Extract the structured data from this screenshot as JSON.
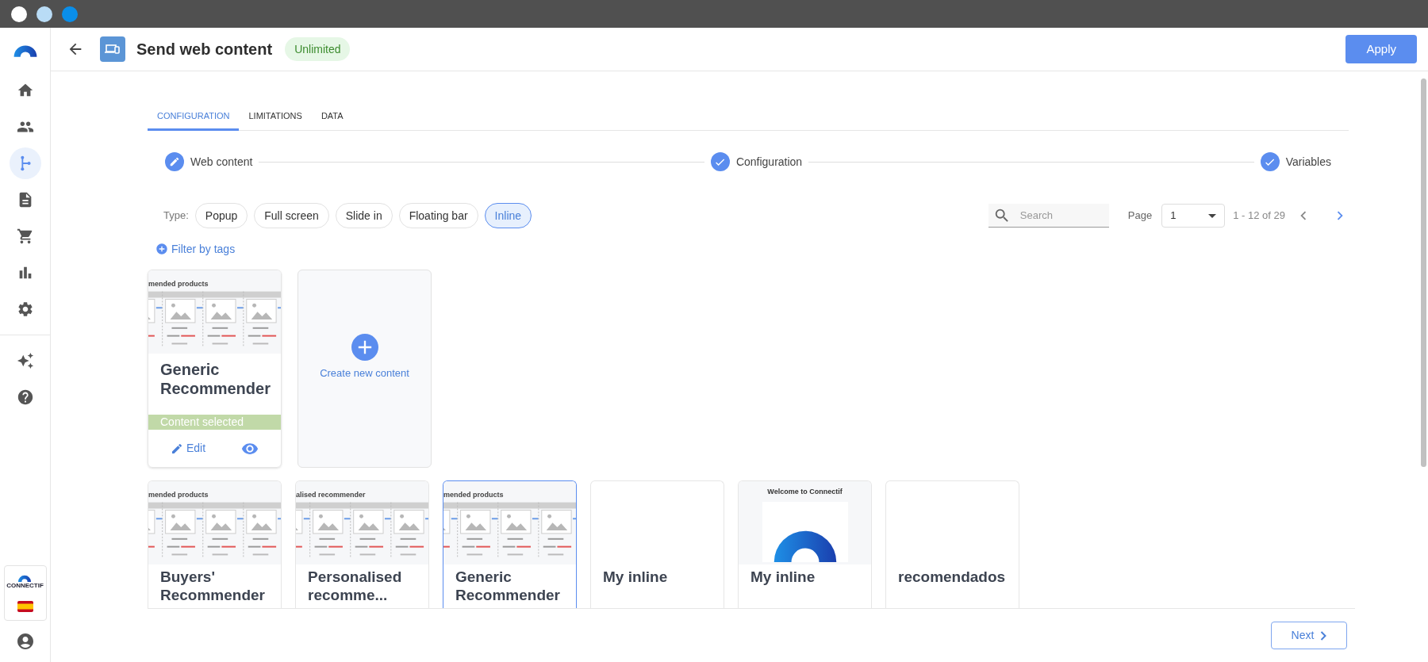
{
  "sidebar": {
    "items": [
      {
        "kind": "home",
        "selected": false
      },
      {
        "kind": "people",
        "selected": false
      },
      {
        "kind": "flow",
        "selected": true
      },
      {
        "kind": "document",
        "selected": false
      },
      {
        "kind": "cart",
        "selected": false
      },
      {
        "kind": "chart",
        "selected": false
      },
      {
        "kind": "settings",
        "selected": false
      },
      {
        "kind": "sparkles",
        "selected": false
      },
      {
        "kind": "help",
        "selected": false
      }
    ],
    "brand_text": "CONNECTIF"
  },
  "header": {
    "title": "Send web content",
    "badge": "Unlimited",
    "apply": "Apply"
  },
  "tabs": [
    {
      "label": "CONFIGURATION",
      "selected": true
    },
    {
      "label": "LIMITATIONS",
      "selected": false
    },
    {
      "label": "DATA",
      "selected": false
    }
  ],
  "steps": [
    {
      "label": "Web content",
      "kind": "edit"
    },
    {
      "label": "Configuration",
      "kind": "done"
    },
    {
      "label": "Variables",
      "kind": "done"
    }
  ],
  "type_filter": {
    "label": "Type:",
    "options": [
      {
        "label": "Popup",
        "selected": false
      },
      {
        "label": "Full screen",
        "selected": false
      },
      {
        "label": "Slide in",
        "selected": false
      },
      {
        "label": "Floating bar",
        "selected": false
      },
      {
        "label": "Inline",
        "selected": true
      }
    ]
  },
  "filter_by_tags": "Filter by tags",
  "search": {
    "placeholder": "Search"
  },
  "pagination": {
    "label": "Page",
    "value": "1",
    "range": "1 - 12 of 29"
  },
  "selected_content": {
    "title": "Generic Recommender",
    "preview": {
      "kind": "recommender",
      "caption": "mended products"
    },
    "status": "Content selected",
    "edit": "Edit"
  },
  "create_card": {
    "label": "Create new content"
  },
  "contents": [
    {
      "title": "Buyers' Recommender",
      "selected": false,
      "preview": {
        "kind": "recommender",
        "caption": "mended products"
      }
    },
    {
      "title": "Personalised recomme...",
      "selected": false,
      "preview": {
        "kind": "recommender",
        "caption": "alised recommender"
      }
    },
    {
      "title": "Generic Recommender",
      "selected": true,
      "preview": {
        "kind": "recommender",
        "caption": "mended products"
      }
    },
    {
      "title": "My inline",
      "selected": false,
      "preview": {
        "kind": "blank"
      }
    },
    {
      "title": "My inline",
      "selected": false,
      "preview": {
        "kind": "welcome",
        "caption": "Welcome to Connectif"
      }
    },
    {
      "title": "recomendados",
      "selected": false,
      "preview": {
        "kind": "blank"
      }
    }
  ],
  "footer": {
    "next": "Next"
  }
}
